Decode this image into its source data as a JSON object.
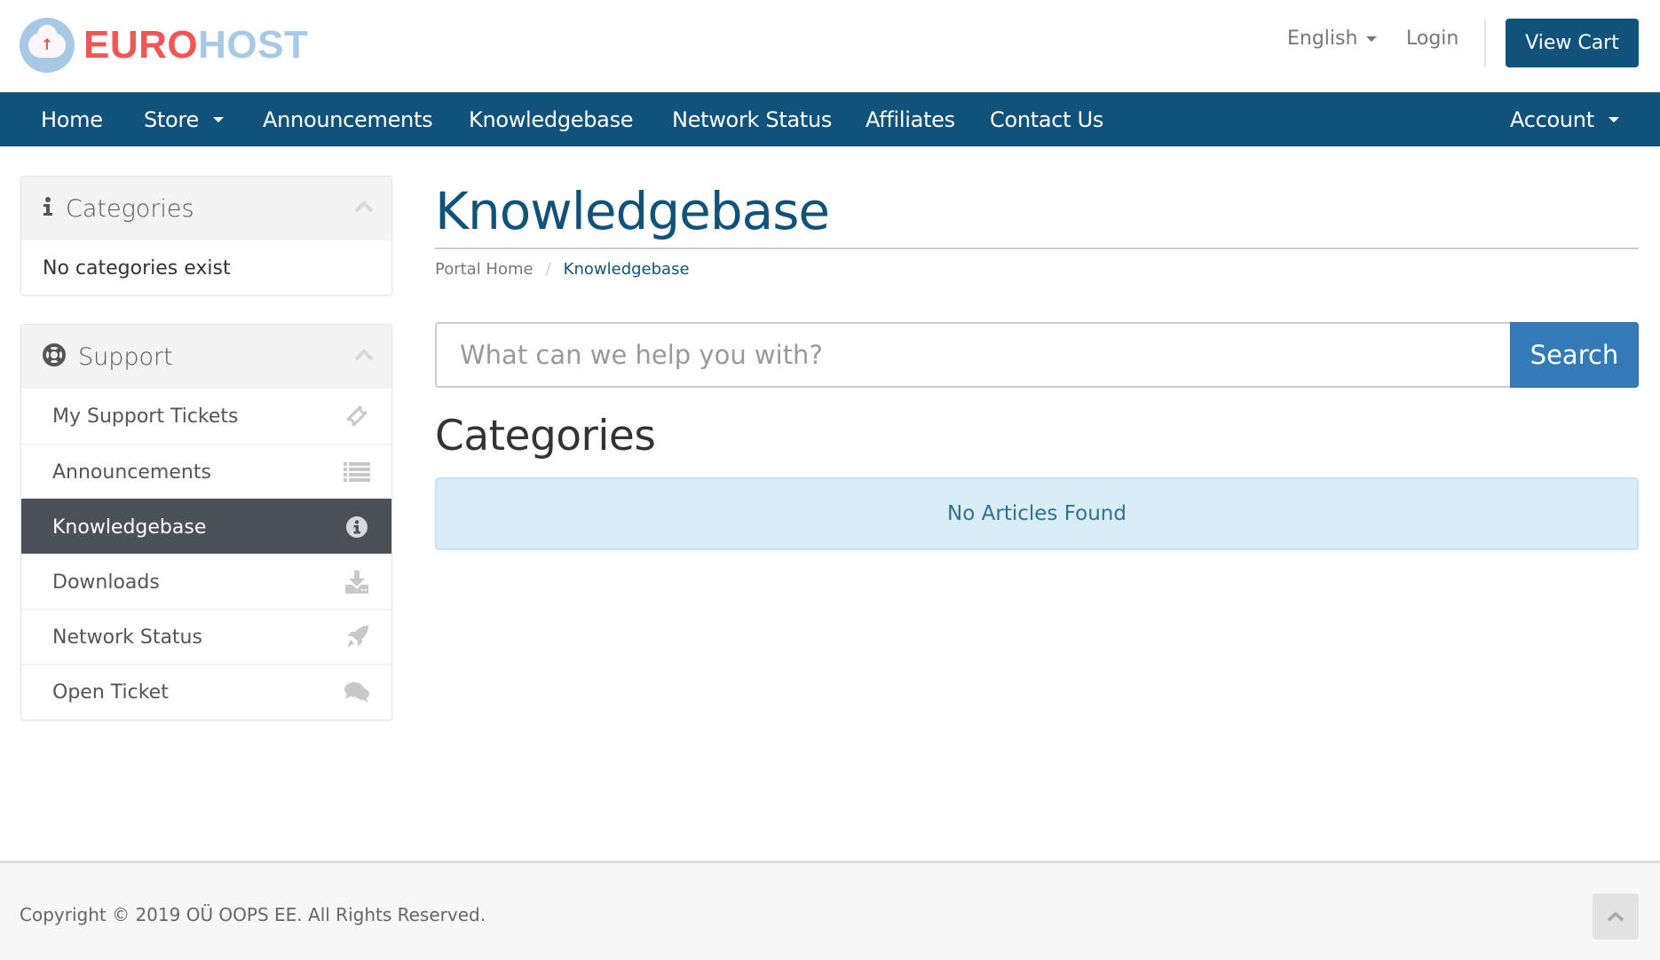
{
  "brand": {
    "name_part1": "EURO",
    "name_part2": "HOST",
    "logo_icon": "cloud-upload-icon",
    "colors": {
      "primary": "#105279",
      "logo_red": "#ef5654",
      "logo_blue": "#a8c9e6"
    }
  },
  "header": {
    "language_label": "English",
    "login_label": "Login",
    "view_cart_label": "View Cart"
  },
  "navbar": {
    "items": [
      {
        "label": "Home",
        "has_dropdown": false
      },
      {
        "label": "Store",
        "has_dropdown": true
      },
      {
        "label": "Announcements",
        "has_dropdown": false
      },
      {
        "label": "Knowledgebase",
        "has_dropdown": false
      },
      {
        "label": "Network Status",
        "has_dropdown": false
      },
      {
        "label": "Affiliates",
        "has_dropdown": false
      },
      {
        "label": "Contact Us",
        "has_dropdown": false
      }
    ],
    "account_label": "Account"
  },
  "sidebar": {
    "categories_panel": {
      "title": "Categories",
      "icon": "info-icon",
      "empty_text": "No categories exist"
    },
    "support_panel": {
      "title": "Support",
      "icon": "life-ring-icon",
      "items": [
        {
          "label": "My Support Tickets",
          "icon": "ticket-icon",
          "active": false
        },
        {
          "label": "Announcements",
          "icon": "list-icon",
          "active": false
        },
        {
          "label": "Knowledgebase",
          "icon": "info-circle-icon",
          "active": true
        },
        {
          "label": "Downloads",
          "icon": "download-icon",
          "active": false
        },
        {
          "label": "Network Status",
          "icon": "rocket-icon",
          "active": false
        },
        {
          "label": "Open Ticket",
          "icon": "comments-icon",
          "active": false
        }
      ]
    }
  },
  "main": {
    "page_title": "Knowledgebase",
    "breadcrumb": {
      "home": "Portal Home",
      "separator": "/",
      "current": "Knowledgebase"
    },
    "search": {
      "placeholder": "What can we help you with?",
      "value": "",
      "button_label": "Search"
    },
    "section_title": "Categories",
    "alert_text": "No Articles Found"
  },
  "footer": {
    "copyright": "Copyright © 2019 OÜ OOPS EE. All Rights Reserved.",
    "back_to_top_icon": "chevron-up-icon"
  }
}
